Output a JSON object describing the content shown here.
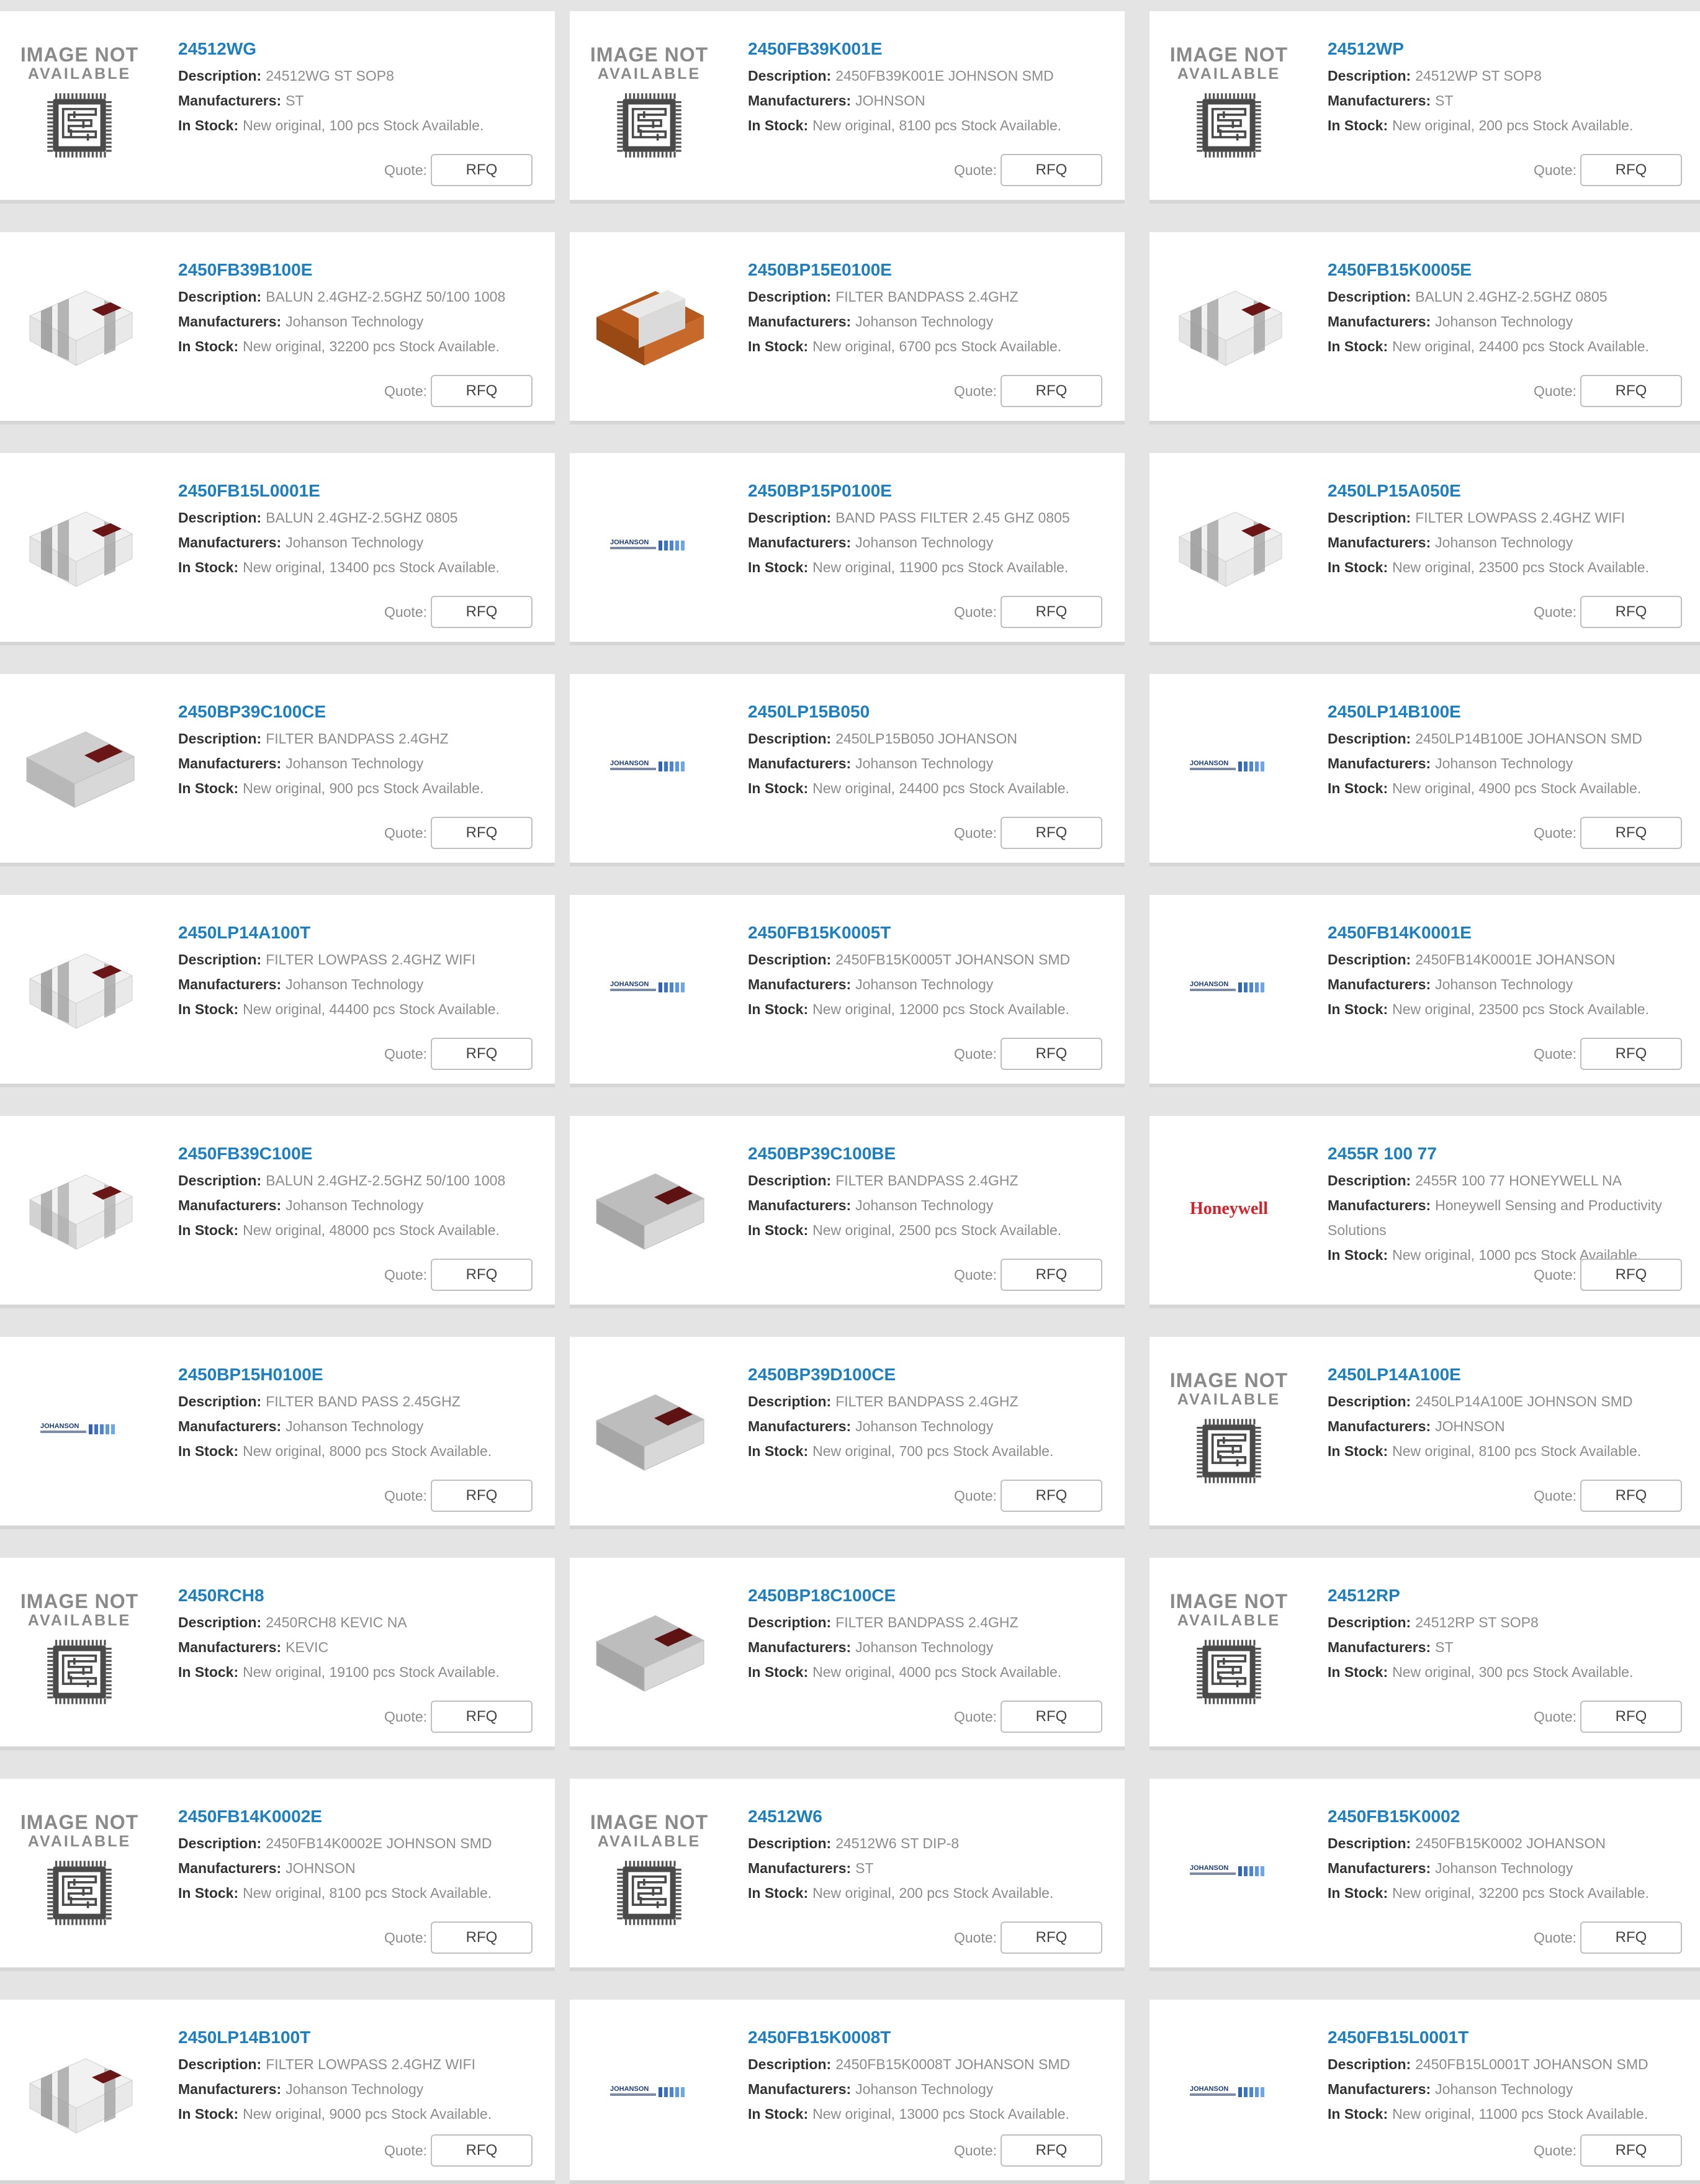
{
  "labels": {
    "description": "Description:",
    "manufacturers": "Manufacturers:",
    "in_stock": "In Stock:",
    "quote": "Quote:",
    "rfq": "RFQ"
  },
  "placeholder": {
    "line1": "IMAGE NOT",
    "line2": "AVAILABLE"
  },
  "colors": {
    "part_link": "#1c7fc2",
    "label": "#333333",
    "value": "#8c8c8c",
    "background": "#e4e4e4",
    "card": "#ffffff"
  },
  "products": [
    {
      "part": "24512WG",
      "description": "24512WG ST SOP8",
      "manufacturer": "ST",
      "stock": "New original, 100 pcs Stock Available.",
      "image": "chip-placeholder-icon"
    },
    {
      "part": "2450FB39K001E",
      "description": "2450FB39K001E JOHNSON SMD",
      "manufacturer": "JOHNSON",
      "stock": "New original, 8100 pcs Stock Available.",
      "image": "chip-placeholder-icon"
    },
    {
      "part": "24512WP",
      "description": "24512WP ST SOP8",
      "manufacturer": "ST",
      "stock": "New original, 200 pcs Stock Available.",
      "image": "chip-placeholder-icon"
    },
    {
      "part": "2450FB39B100E",
      "description": "BALUN 2.4GHZ-2.5GHZ 50/100 1008",
      "manufacturer": "Johanson Technology",
      "stock": "New original, 32200 pcs Stock Available.",
      "image": "striped-chip-icon"
    },
    {
      "part": "2450BP15E0100E",
      "description": "FILTER BANDPASS 2.4GHZ",
      "manufacturer": "Johanson Technology",
      "stock": "New original, 6700 pcs Stock Available.",
      "image": "orange-chip-icon"
    },
    {
      "part": "2450FB15K0005E",
      "description": "BALUN 2.4GHZ-2.5GHZ 0805",
      "manufacturer": "Johanson Technology",
      "stock": "New original, 24400 pcs Stock Available.",
      "image": "striped-chip-icon"
    },
    {
      "part": "2450FB15L0001E",
      "description": "BALUN 2.4GHZ-2.5GHZ 0805",
      "manufacturer": "Johanson Technology",
      "stock": "New original, 13400 pcs Stock Available.",
      "image": "striped-chip-icon"
    },
    {
      "part": "2450BP15P0100E",
      "description": "BAND PASS FILTER 2.45 GHZ 0805",
      "manufacturer": "Johanson Technology",
      "stock": "New original, 11900 pcs Stock Available.",
      "image": "johanson-logo-icon"
    },
    {
      "part": "2450LP15A050E",
      "description": "FILTER LOWPASS 2.4GHZ WIFI",
      "manufacturer": "Johanson Technology",
      "stock": "New original, 23500 pcs Stock Available.",
      "image": "striped-chip-icon"
    },
    {
      "part": "2450BP39C100CE",
      "description": "FILTER BANDPASS 2.4GHZ",
      "manufacturer": "Johanson Technology",
      "stock": "New original, 900 pcs Stock Available.",
      "image": "grey-chip-icon"
    },
    {
      "part": "2450LP15B050",
      "description": "2450LP15B050 JOHANSON",
      "manufacturer": "Johanson Technology",
      "stock": "New original, 24400 pcs Stock Available.",
      "image": "johanson-logo-icon"
    },
    {
      "part": "2450LP14B100E",
      "description": "2450LP14B100E JOHANSON SMD",
      "manufacturer": "Johanson Technology",
      "stock": "New original, 4900 pcs Stock Available.",
      "image": "johanson-logo-icon"
    },
    {
      "part": "2450LP14A100T",
      "description": "FILTER LOWPASS 2.4GHZ WIFI",
      "manufacturer": "Johanson Technology",
      "stock": "New original, 44400 pcs Stock Available.",
      "image": "striped-chip-icon"
    },
    {
      "part": "2450FB15K0005T",
      "description": "2450FB15K0005T JOHANSON SMD",
      "manufacturer": "Johanson Technology",
      "stock": "New original, 12000 pcs Stock Available.",
      "image": "johanson-logo-icon"
    },
    {
      "part": "2450FB14K0001E",
      "description": "2450FB14K0001E JOHANSON",
      "manufacturer": "Johanson Technology",
      "stock": "New original, 23500 pcs Stock Available.",
      "image": "johanson-logo-icon"
    },
    {
      "part": "2450FB39C100E",
      "description": "BALUN 2.4GHZ-2.5GHZ 50/100 1008",
      "manufacturer": "Johanson Technology",
      "stock": "New original, 48000 pcs Stock Available.",
      "image": "grey-striped-chip-icon"
    },
    {
      "part": "2450BP39C100BE",
      "description": "FILTER BANDPASS 2.4GHZ",
      "manufacturer": "Johanson Technology",
      "stock": "New original, 2500 pcs Stock Available.",
      "image": "dark-chip-icon"
    },
    {
      "part": "2455R 100 77",
      "description": "2455R 100 77 HONEYWELL NA",
      "manufacturer": "Honeywell Sensing and Productivity Solutions",
      "stock": "New original, 1000 pcs Stock Available.",
      "image": "honeywell-logo-icon"
    },
    {
      "part": "2450BP15H0100E",
      "description": "FILTER BAND PASS 2.45GHZ",
      "manufacturer": "Johanson Technology",
      "stock": "New original, 8000 pcs Stock Available.",
      "image": "johanson-logo-icon"
    },
    {
      "part": "2450BP39D100CE",
      "description": "FILTER BANDPASS 2.4GHZ",
      "manufacturer": "Johanson Technology",
      "stock": "New original, 700 pcs Stock Available.",
      "image": "dark-chip-icon"
    },
    {
      "part": "2450LP14A100E",
      "description": "2450LP14A100E JOHNSON SMD",
      "manufacturer": "JOHNSON",
      "stock": "New original, 8100 pcs Stock Available.",
      "image": "chip-placeholder-icon"
    },
    {
      "part": "2450RCH8",
      "description": "2450RCH8 KEVIC NA",
      "manufacturer": "KEVIC",
      "stock": "New original, 19100 pcs Stock Available.",
      "image": "chip-placeholder-icon"
    },
    {
      "part": "2450BP18C100CE",
      "description": "FILTER BANDPASS 2.4GHZ",
      "manufacturer": "Johanson Technology",
      "stock": "New original, 4000 pcs Stock Available.",
      "image": "dark-chip-icon"
    },
    {
      "part": "24512RP",
      "description": "24512RP ST SOP8",
      "manufacturer": "ST",
      "stock": "New original, 300 pcs Stock Available.",
      "image": "chip-placeholder-icon"
    },
    {
      "part": "2450FB14K0002E",
      "description": "2450FB14K0002E JOHNSON SMD",
      "manufacturer": "JOHNSON",
      "stock": "New original, 8100 pcs Stock Available.",
      "image": "chip-placeholder-icon"
    },
    {
      "part": "24512W6",
      "description": "24512W6 ST DIP-8",
      "manufacturer": "ST",
      "stock": "New original, 200 pcs Stock Available.",
      "image": "chip-placeholder-icon"
    },
    {
      "part": "2450FB15K0002",
      "description": "2450FB15K0002 JOHANSON",
      "manufacturer": "Johanson Technology",
      "stock": "New original, 32200 pcs Stock Available.",
      "image": "johanson-logo-icon"
    },
    {
      "part": "2450LP14B100T",
      "description": "FILTER LOWPASS 2.4GHZ WIFI",
      "manufacturer": "Johanson Technology",
      "stock": "New original, 9000 pcs Stock Available.",
      "image": "striped-chip-icon"
    },
    {
      "part": "2450FB15K0008T",
      "description": "2450FB15K0008T JOHANSON SMD",
      "manufacturer": "Johanson Technology",
      "stock": "New original, 13000 pcs Stock Available.",
      "image": "johanson-logo-icon"
    },
    {
      "part": "2450FB15L0001T",
      "description": "2450FB15L0001T JOHANSON SMD",
      "manufacturer": "Johanson Technology",
      "stock": "New original, 11000 pcs Stock Available.",
      "image": "johanson-logo-icon"
    }
  ]
}
